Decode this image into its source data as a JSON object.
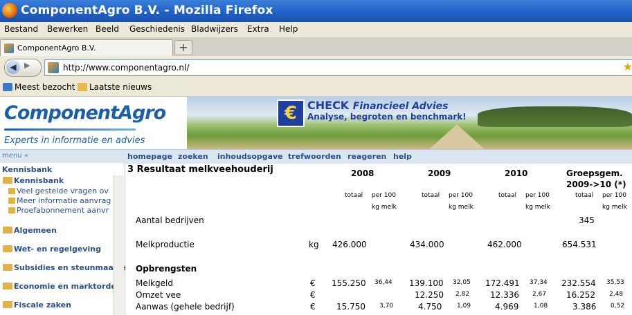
{
  "window": {
    "title": "ComponentAgro B.V. - Mozilla Firefox"
  },
  "menu": [
    "Bestand",
    "Bewerken",
    "Beeld",
    "Geschiedenis",
    "Bladwijzers",
    "Extra",
    "Help"
  ],
  "tab": {
    "label": "ComponentAgro B.V.",
    "new_tab": "+"
  },
  "address": {
    "url": "http://www.componentagro.nl/"
  },
  "bookmarks": [
    "Meest bezocht",
    "Laatste nieuws"
  ],
  "banner": {
    "logo_component": "Component",
    "logo_agro": "Agro",
    "tagline": "Experts in informatie en advies",
    "euro": "€",
    "check_a": "CHECK",
    "check_b": "Financieel Advies",
    "check_sub": "Analyse, begroten en benchmark!"
  },
  "nav": {
    "menu_label": "menu «",
    "links": [
      "homepage",
      "zoeken",
      "inhoudsopgave",
      "trefwoorden",
      "reageren",
      "help"
    ]
  },
  "sidebar": {
    "header": "Kennisbank",
    "section": "Kennisbank",
    "sub_items": [
      "Veel gestelde vragen ov",
      "Meer informatie aanvrag",
      "Proefabonnement aanvr"
    ],
    "items": [
      "Algemeen",
      "Wet- en regelgeving",
      "Subsidies en steunmaatre",
      "Economie en marktordeni",
      "Fiscale zaken"
    ]
  },
  "content": {
    "heading": "3 Resultaat melkveehouderij",
    "years": [
      "2008",
      "2009",
      "2010"
    ],
    "group_header_1": "Groepsgem.",
    "group_header_2": "2009->10 (*)",
    "col_totaal": "totaal",
    "col_per100": "per 100",
    "col_kgmelk": "kg melk",
    "rows": {
      "aantal": {
        "label": "Aantal bedrijven",
        "group": "345"
      },
      "melkprod": {
        "label": "Melkproductie",
        "unit": "kg",
        "v2008": "426.000",
        "v2009": "434.000",
        "v2010": "462.000",
        "group": "654.531"
      },
      "opbrengsten": {
        "label": "Opbrengsten"
      },
      "melkgeld": {
        "label": "Melkgeld",
        "unit": "€",
        "v2008": "155.250",
        "p2008": "36,44",
        "v2009": "139.100",
        "p2009": "32,05",
        "v2010": "172.491",
        "p2010": "37,34",
        "group": "232.554",
        "pgroup": "35,53"
      },
      "omzetvee": {
        "label": "Omzet vee",
        "unit": "€",
        "v2009": "12.250",
        "p2009": "2,82",
        "v2010": "12.336",
        "p2010": "2,67",
        "group": "16.252",
        "pgroup": "2,48"
      },
      "aanwas": {
        "label": "Aanwas (gehele bedrijf)",
        "unit": "€",
        "v2008": "15.750",
        "p2008": "3,70",
        "v2009": "4.750",
        "p2009": "1,09",
        "v2010": "4.969",
        "p2010": "1,08",
        "group": "3.386",
        "pgroup": "0,52"
      }
    }
  }
}
